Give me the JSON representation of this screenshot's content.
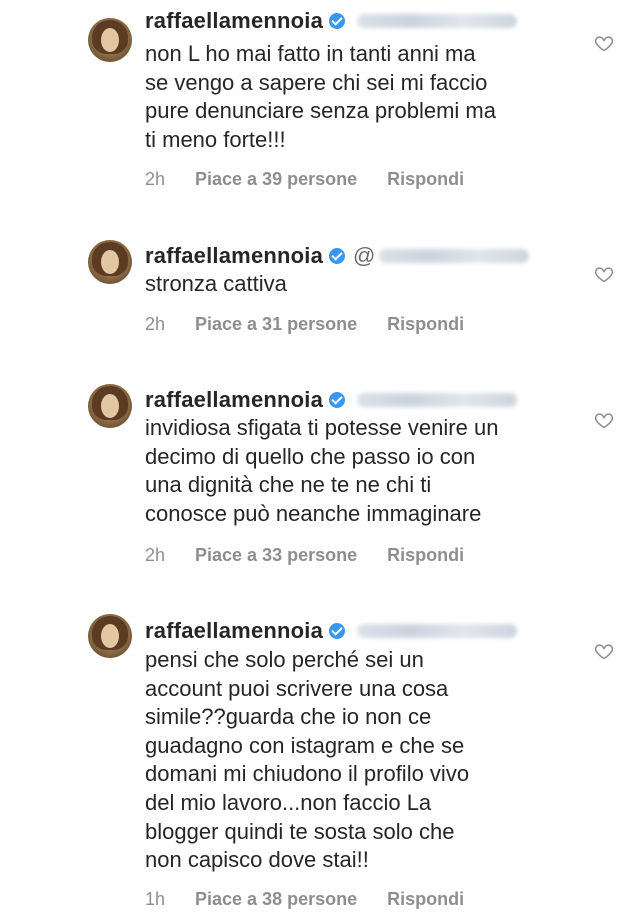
{
  "comments": [
    {
      "username": "raffaellamennoia",
      "mention_prefix": "",
      "text": "non L ho mai fatto in tanti anni ma\nse vengo a sapere chi sei mi faccio\npure denunciare senza problemi ma\nti meno forte!!!",
      "time": "2h",
      "likes": "Piace a 39 persone",
      "reply": "Rispondi"
    },
    {
      "username": "raffaellamennoia",
      "mention_prefix": "@",
      "text": "stronza cattiva",
      "time": "2h",
      "likes": "Piace a 31 persone",
      "reply": "Rispondi"
    },
    {
      "username": "raffaellamennoia",
      "mention_prefix": "",
      "text": "invidiosa sfigata ti potesse venire un\ndecimo di quello che passo io con\nuna dignità che ne te ne chi ti\nconosce può neanche immaginare",
      "time": "2h",
      "likes": "Piace a 33 persone",
      "reply": "Rispondi"
    },
    {
      "username": "raffaellamennoia",
      "mention_prefix": "",
      "text": "pensi che solo perché sei un\naccount puoi scrivere una cosa\nsimile??guarda che io non ce\nguadagno con istagram e che se\ndomani mi chiudono il profilo vivo\ndel mio lavoro...non faccio La\nblogger quindi te sosta solo che\nnon capisco dove stai!!",
      "time": "1h",
      "likes": "Piace a 38 persone",
      "reply": "Rispondi"
    }
  ],
  "icons": {
    "verified": "verified-badge-icon",
    "like": "heart-outline-icon",
    "avatar": "profile-avatar"
  },
  "colors": {
    "text": "#262626",
    "secondary": "#8e8e8e",
    "verified": "#3897f0"
  }
}
